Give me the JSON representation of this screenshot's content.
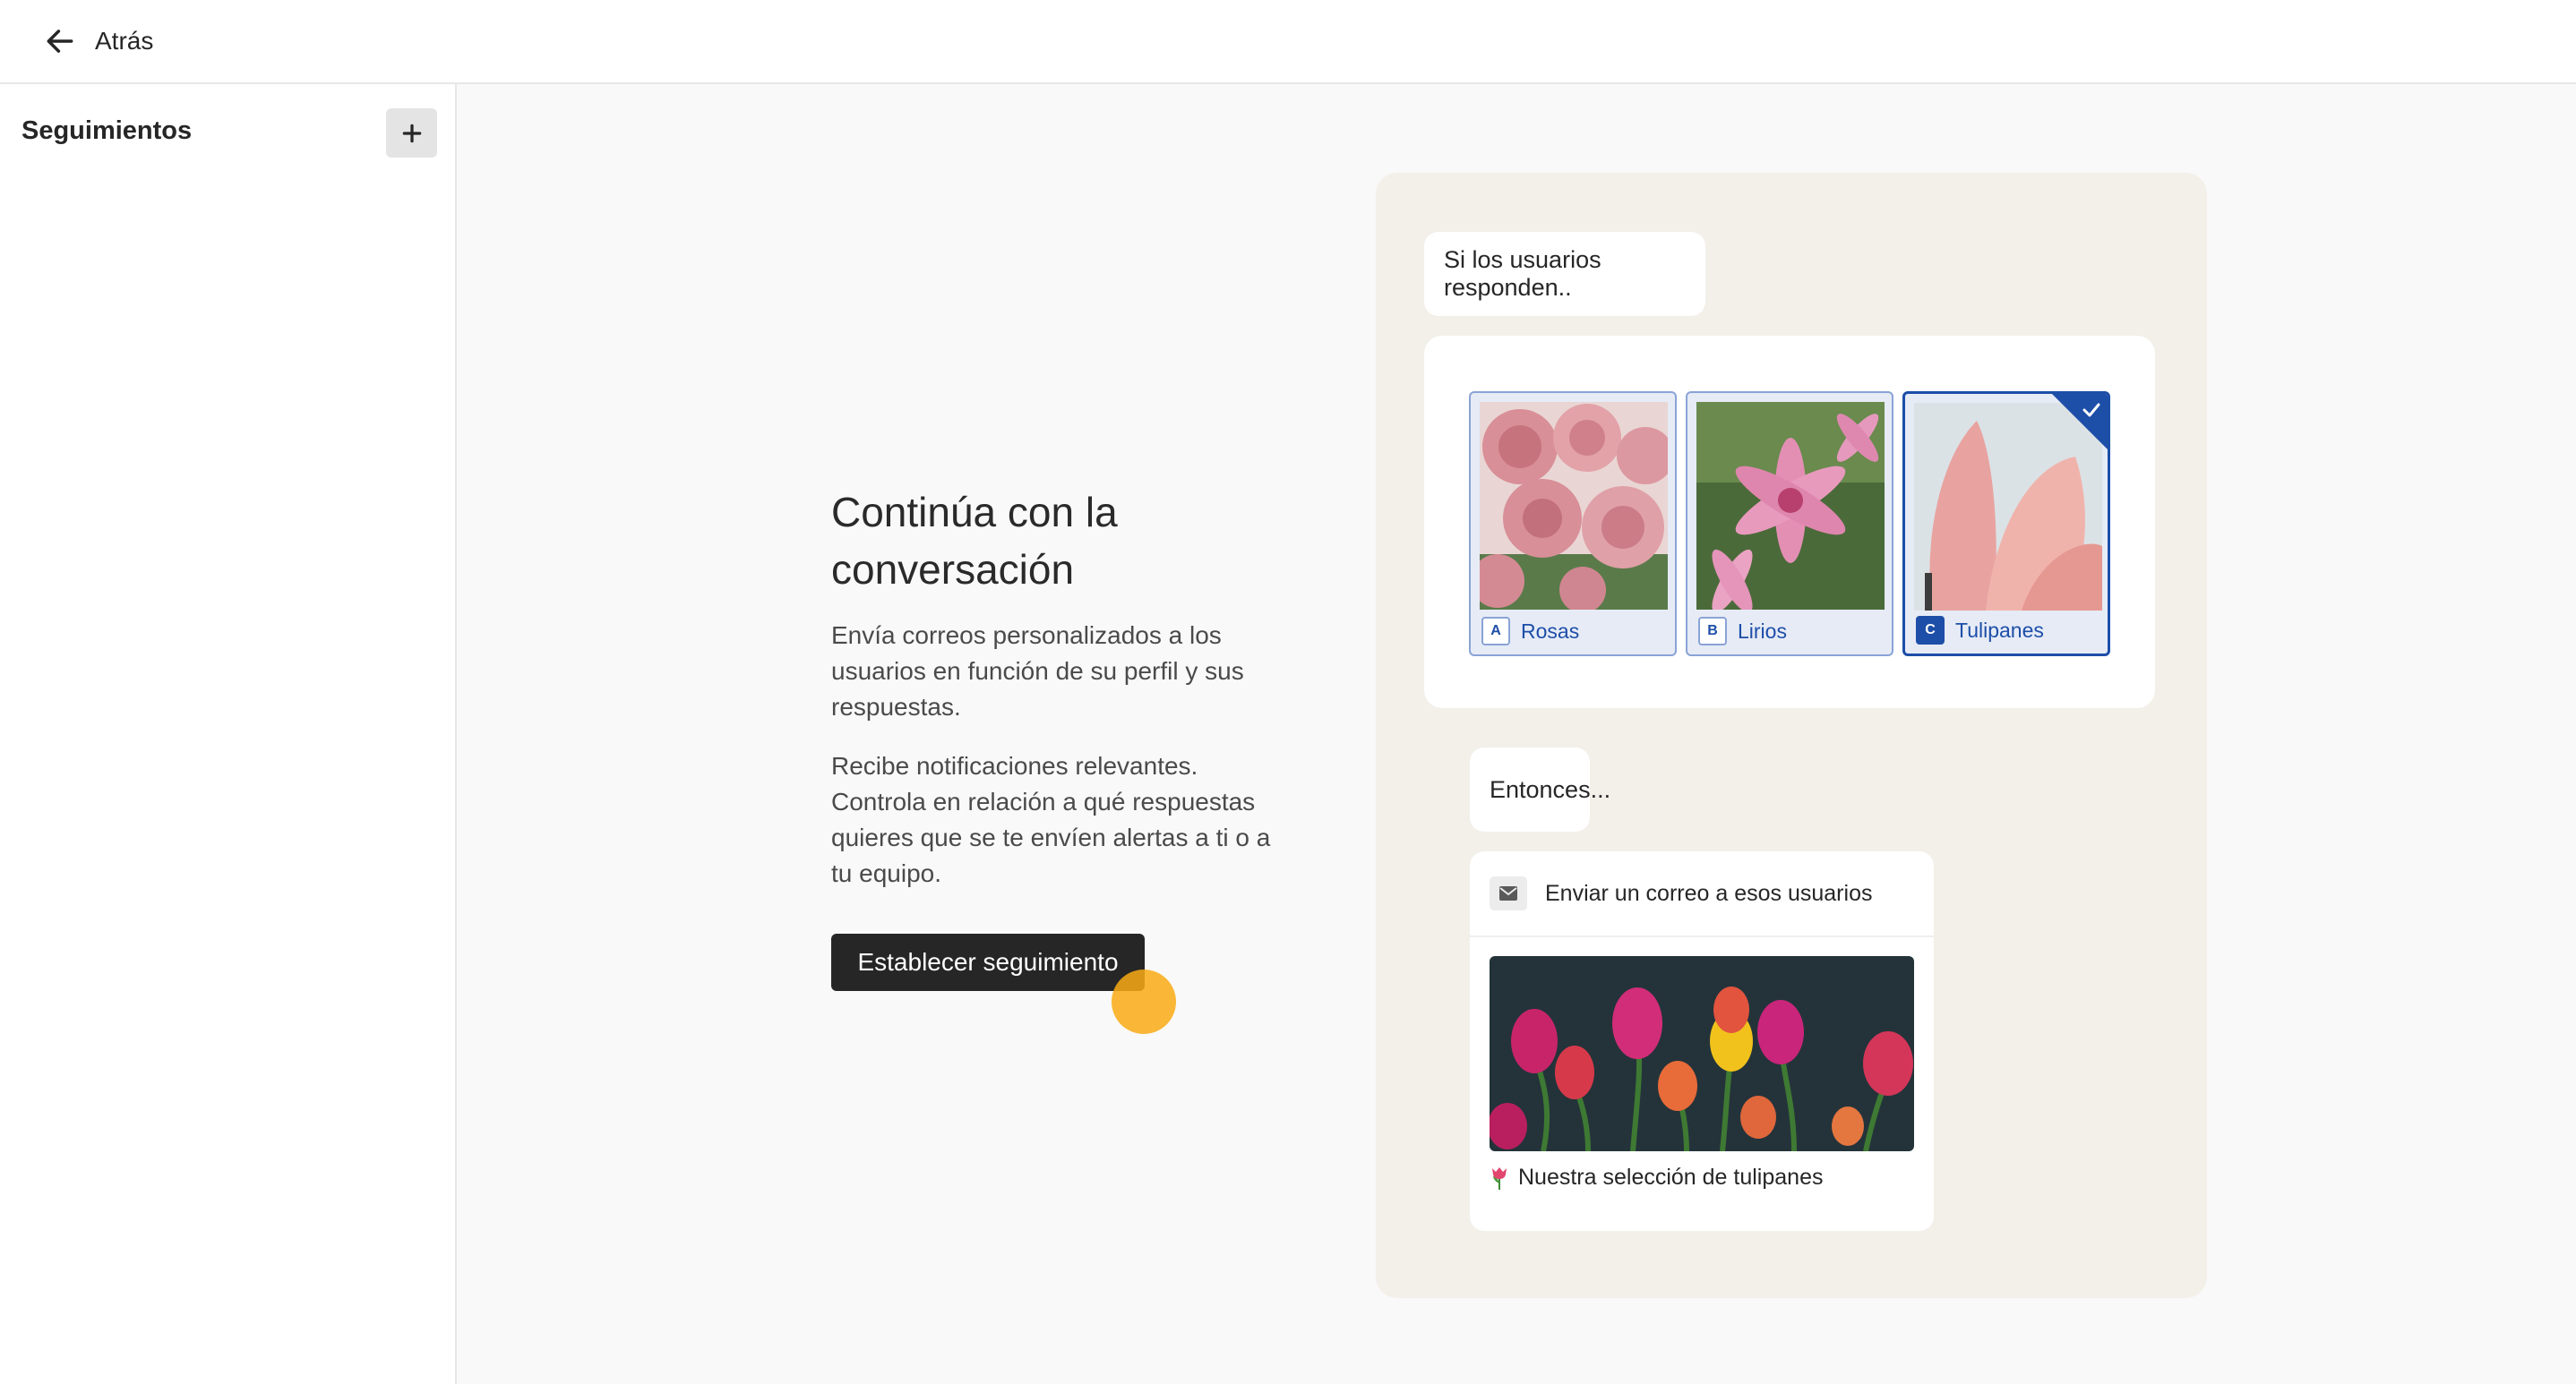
{
  "topbar": {
    "back_label": "Atrás",
    "back_icon": "arrow-left-icon"
  },
  "sidebar": {
    "title": "Seguimientos",
    "add_icon": "plus-icon"
  },
  "intro": {
    "heading": "Continúa con la conversación",
    "paragraph_1": "Envía correos personalizados a los usuarios en función de su perfil y sus respuestas.",
    "paragraph_2": "Recibe notificaciones relevantes. Controla en relación a qué respuestas quieres que se te envíen alertas a ti o a tu equipo.",
    "cta_label": "Establecer seguimiento"
  },
  "illustration": {
    "if_text": "Si los usuarios responden..",
    "then_text": "Entonces...",
    "choices": [
      {
        "key": "A",
        "label": "Rosas",
        "selected": false
      },
      {
        "key": "B",
        "label": "Lirios",
        "selected": false
      },
      {
        "key": "C",
        "label": "Tulipanes",
        "selected": true
      }
    ],
    "email": {
      "action_label": "Enviar un correo a esos usuarios",
      "caption": "Nuestra selección de tulipanes",
      "caption_icon": "tulip-emoji-icon",
      "mail_icon": "envelope-icon"
    }
  },
  "colors": {
    "accent": "#1d4ea8",
    "cta_background": "#262626",
    "panel_background": "#f3efe9",
    "cursor_highlight": "#faaa14"
  }
}
